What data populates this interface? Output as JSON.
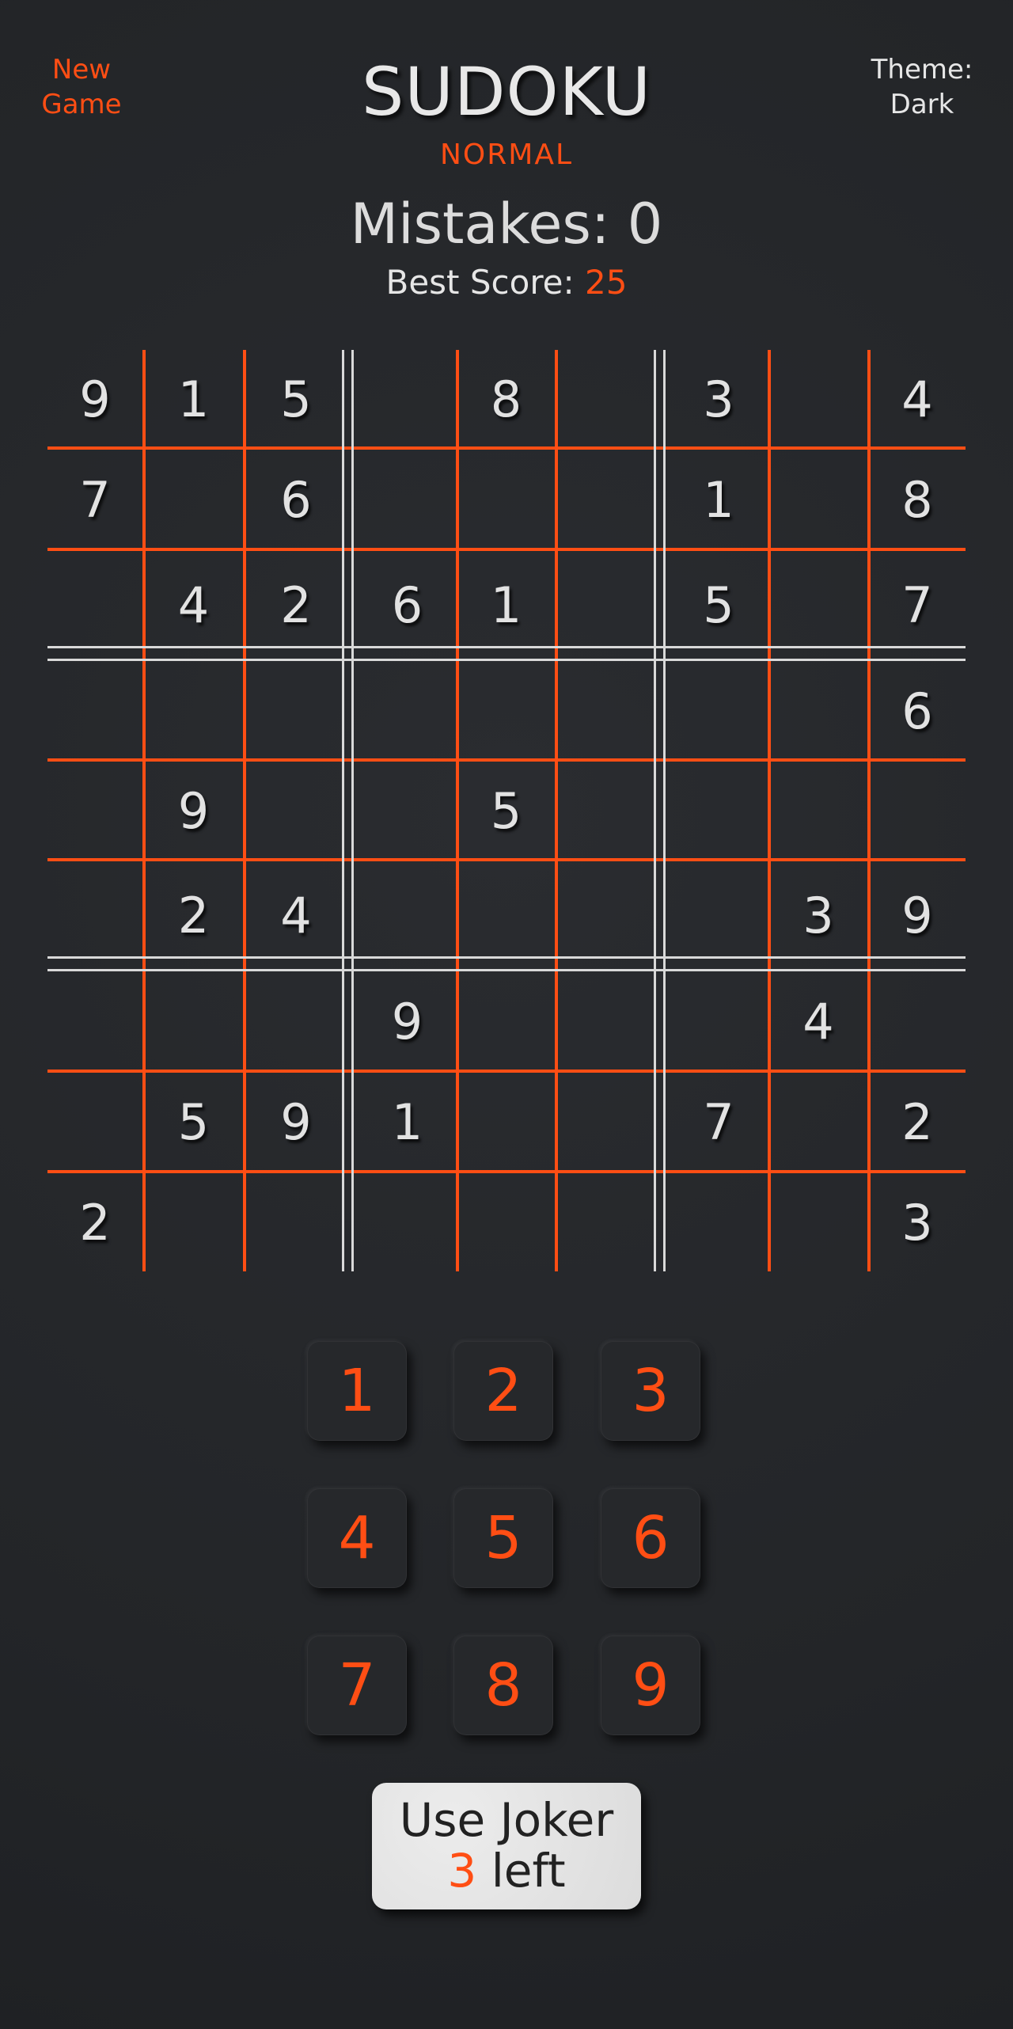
{
  "header": {
    "new_game": "New Game",
    "title": "SUDOKU",
    "difficulty": "NORMAL",
    "theme_label": "Theme:",
    "theme_value": "Dark"
  },
  "stats": {
    "mistakes_label": "Mistakes:",
    "mistakes_value": "0",
    "best_score_label": "Best Score:",
    "best_score_value": "25"
  },
  "board": [
    [
      "9",
      "1",
      "5",
      "",
      "8",
      "",
      "3",
      "",
      "4"
    ],
    [
      "7",
      "",
      "6",
      "",
      "",
      "",
      "1",
      "",
      "8"
    ],
    [
      "",
      "4",
      "2",
      "6",
      "1",
      "",
      "5",
      "",
      "7"
    ],
    [
      "",
      "",
      "",
      "",
      "",
      "",
      "",
      "",
      "6"
    ],
    [
      "",
      "9",
      "",
      "",
      "5",
      "",
      "",
      "",
      ""
    ],
    [
      "",
      "2",
      "4",
      "",
      "",
      "",
      "",
      "3",
      "9"
    ],
    [
      "",
      "",
      "",
      "9",
      "",
      "",
      "",
      "4",
      ""
    ],
    [
      "",
      "5",
      "9",
      "1",
      "",
      "",
      "7",
      "",
      "2"
    ],
    [
      "2",
      "",
      "",
      "",
      "",
      "",
      "",
      "",
      "3"
    ]
  ],
  "numpad": [
    "1",
    "2",
    "3",
    "4",
    "5",
    "6",
    "7",
    "8",
    "9"
  ],
  "joker": {
    "label": "Use Joker",
    "count": "3",
    "suffix": "left"
  },
  "colors": {
    "accent": "#ff4e14",
    "background": "#25272a",
    "text": "#e6e6e6",
    "box_divider": "#d9d9d9"
  }
}
